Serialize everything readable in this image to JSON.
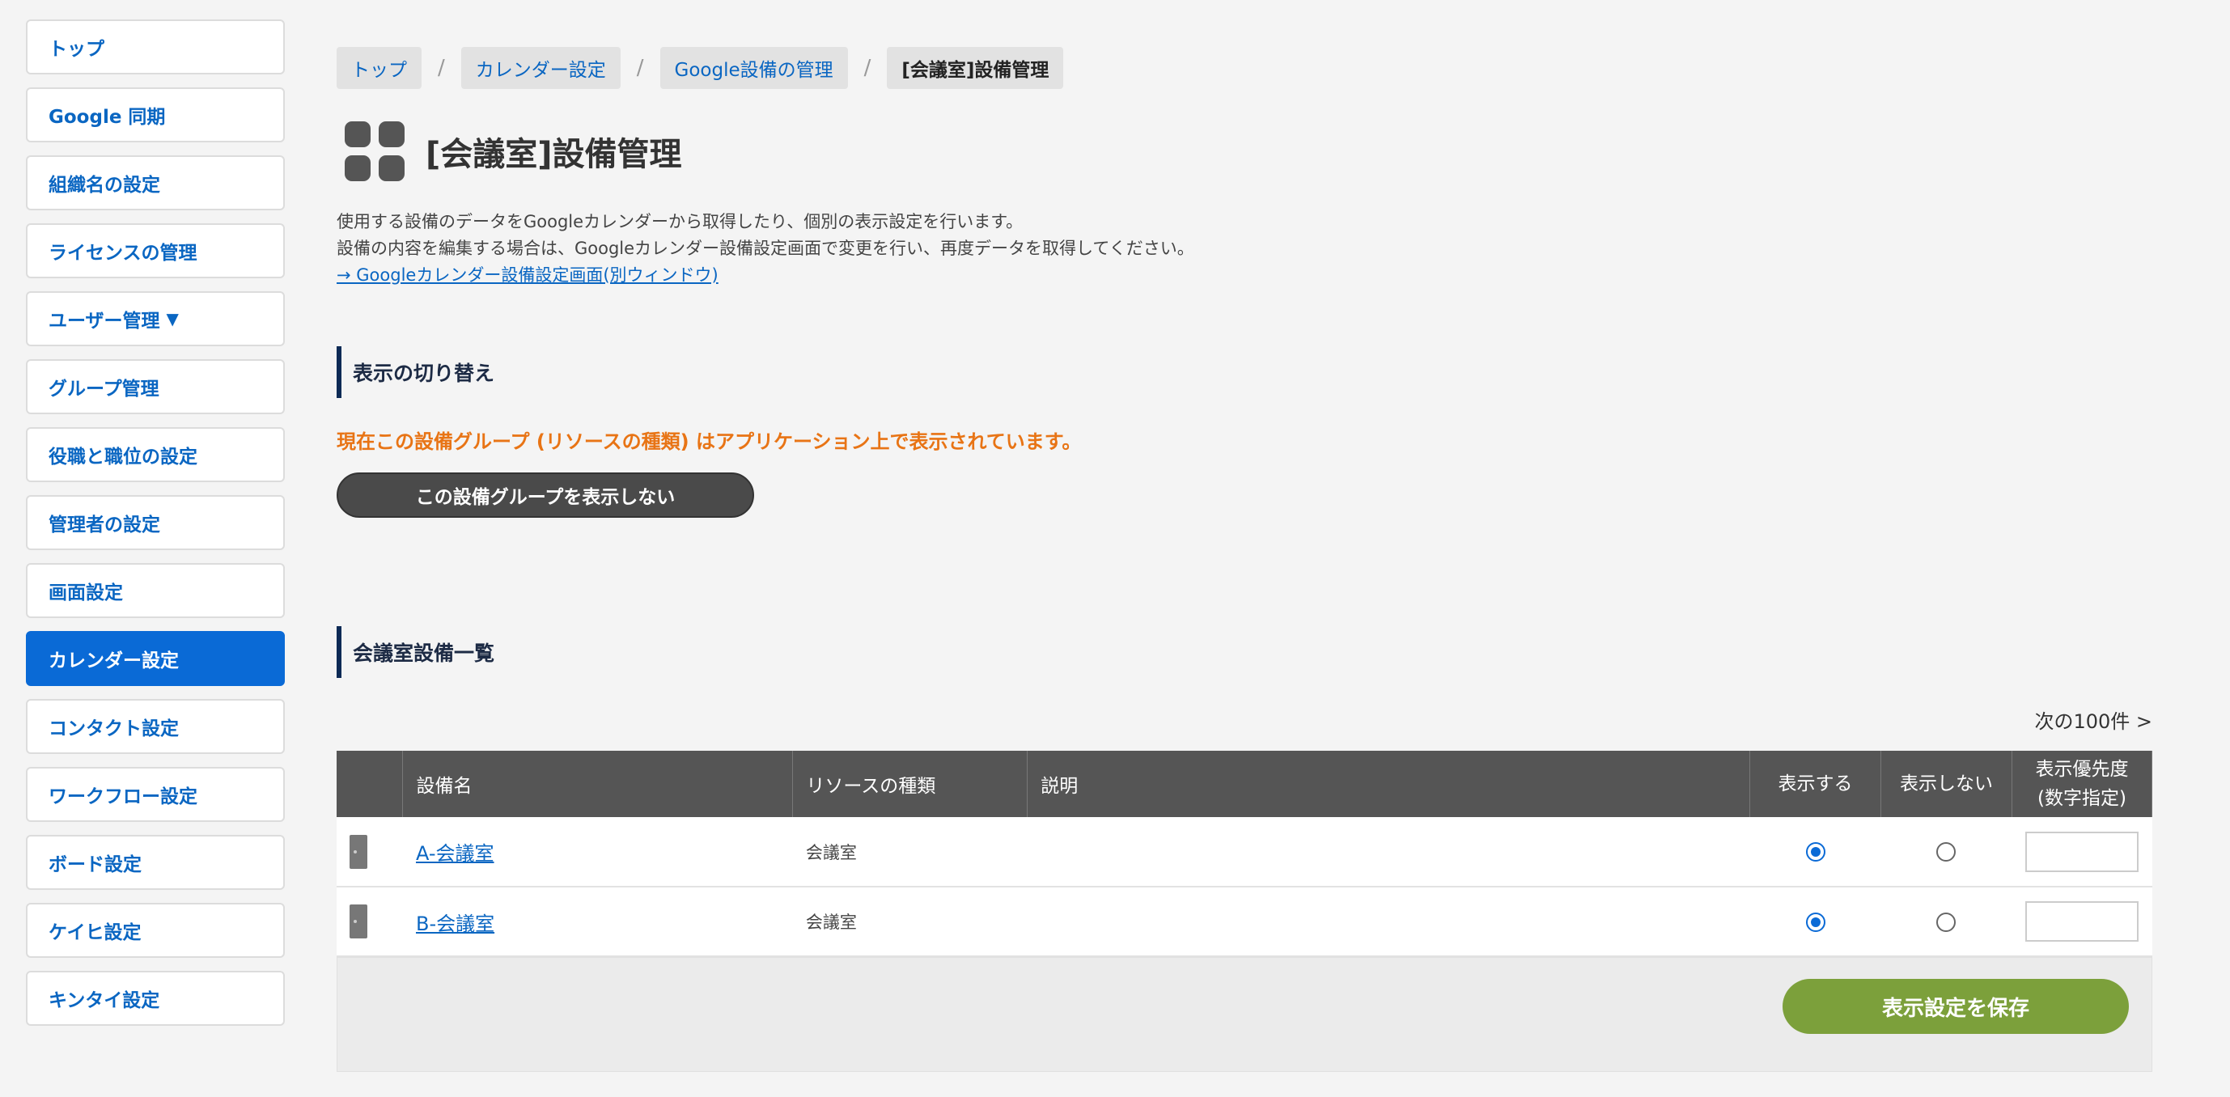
{
  "sidebar": {
    "items": [
      {
        "label": "トップ"
      },
      {
        "label": "Google 同期"
      },
      {
        "label": "組織名の設定"
      },
      {
        "label": "ライセンスの管理"
      },
      {
        "label": "ユーザー管理"
      },
      {
        "label": "グループ管理"
      },
      {
        "label": "役職と職位の設定"
      },
      {
        "label": "管理者の設定"
      },
      {
        "label": "画面設定"
      },
      {
        "label": "カレンダー設定",
        "active": true
      },
      {
        "label": "コンタクト設定"
      },
      {
        "label": "ワークフロー設定"
      },
      {
        "label": "ボード設定"
      },
      {
        "label": "ケイヒ設定"
      },
      {
        "label": "キンタイ設定"
      }
    ],
    "caret": "▼"
  },
  "breadcrumb": {
    "items": [
      "トップ",
      "カレンダー設定",
      "Google設備の管理",
      "[会議室]設備管理"
    ],
    "separator": "/"
  },
  "page": {
    "title": "[会議室]設備管理",
    "desc_line1": "使用する設備のデータをGoogleカレンダーから取得したり、個別の表示設定を行います。",
    "desc_line2": "設備の内容を編集する場合は、Googleカレンダー設備設定画面で変更を行い、再度データを取得してください。",
    "desc_link": "→ Googleカレンダー設備設定画面(別ウィンドウ)"
  },
  "display_toggle": {
    "heading": "表示の切り替え",
    "notice": "現在この設備グループ (リソースの種類) はアプリケーション上で表示されています。",
    "button": "この設備グループを表示しない"
  },
  "resource_list": {
    "heading": "会議室設備一覧",
    "next_link": "次の100件 >",
    "columns": {
      "name": "設備名",
      "type": "リソースの種類",
      "description": "説明",
      "show": "表示する",
      "hide": "表示しない",
      "priority_1": "表示優先度",
      "priority_2": "(数字指定)"
    },
    "rows": [
      {
        "name": "A-会議室",
        "type": "会議室",
        "description": "",
        "show": true,
        "priority": ""
      },
      {
        "name": "B-会議室",
        "type": "会議室",
        "description": "",
        "show": true,
        "priority": ""
      }
    ],
    "save_button": "表示設定を保存"
  },
  "colors": {
    "accent": "#0a6ad6",
    "notice": "#e87415",
    "save": "#7ca03b"
  }
}
